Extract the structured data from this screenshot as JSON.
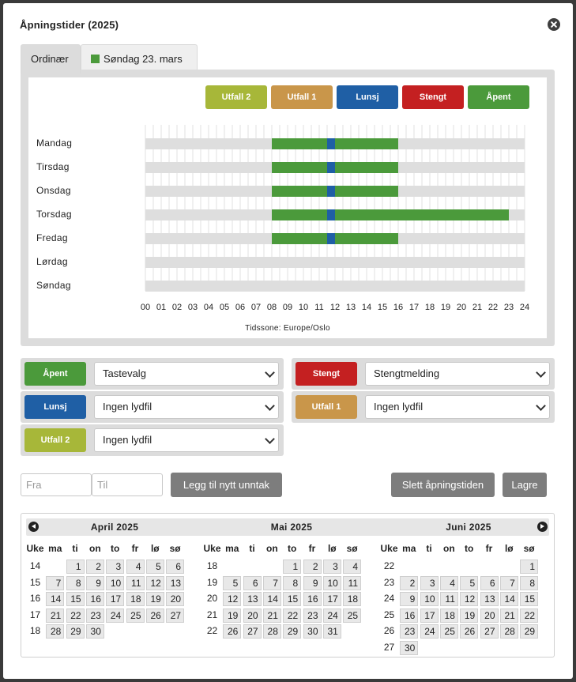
{
  "dialog": {
    "title": "Åpningstider (2025)"
  },
  "tabs": [
    {
      "label": "Ordinær",
      "active": true
    },
    {
      "label": "Søndag 23. mars",
      "active": false,
      "color": "#4b9a3b"
    }
  ],
  "legend": [
    {
      "label": "Utfall 2",
      "color": "#a7b739"
    },
    {
      "label": "Utfall 1",
      "color": "#c9964a"
    },
    {
      "label": "Lunsj",
      "color": "#1f5fa5"
    },
    {
      "label": "Stengt",
      "color": "#c42021"
    },
    {
      "label": "Åpent",
      "color": "#4b9a3b"
    }
  ],
  "chart_data": {
    "type": "timeline",
    "hours_ticks": [
      "00",
      "01",
      "02",
      "03",
      "04",
      "05",
      "06",
      "07",
      "08",
      "09",
      "10",
      "11",
      "12",
      "13",
      "14",
      "15",
      "16",
      "17",
      "18",
      "19",
      "20",
      "21",
      "22",
      "23",
      "24"
    ],
    "timezone": "Tidssone: Europe/Oslo",
    "days": [
      {
        "name": "Mandag",
        "segments": [
          {
            "type": "open",
            "start": 8,
            "end": 11.5
          },
          {
            "type": "lunch",
            "start": 11.5,
            "end": 12
          },
          {
            "type": "open",
            "start": 12,
            "end": 16
          }
        ]
      },
      {
        "name": "Tirsdag",
        "segments": [
          {
            "type": "open",
            "start": 8,
            "end": 11.5
          },
          {
            "type": "lunch",
            "start": 11.5,
            "end": 12
          },
          {
            "type": "open",
            "start": 12,
            "end": 16
          }
        ]
      },
      {
        "name": "Onsdag",
        "segments": [
          {
            "type": "open",
            "start": 8,
            "end": 11.5
          },
          {
            "type": "lunch",
            "start": 11.5,
            "end": 12
          },
          {
            "type": "open",
            "start": 12,
            "end": 16
          }
        ]
      },
      {
        "name": "Torsdag",
        "segments": [
          {
            "type": "open",
            "start": 8,
            "end": 11.5
          },
          {
            "type": "lunch",
            "start": 11.5,
            "end": 12
          },
          {
            "type": "open",
            "start": 12,
            "end": 23
          }
        ]
      },
      {
        "name": "Fredag",
        "segments": [
          {
            "type": "open",
            "start": 8,
            "end": 11.5
          },
          {
            "type": "lunch",
            "start": 11.5,
            "end": 12
          },
          {
            "type": "open",
            "start": 12,
            "end": 16
          }
        ]
      },
      {
        "name": "Lørdag",
        "segments": []
      },
      {
        "name": "Søndag",
        "segments": []
      }
    ],
    "colors": {
      "open": "#4b9a3b",
      "lunch": "#1f5fa5",
      "empty": "#dedede"
    }
  },
  "settings": [
    {
      "label": "Åpent",
      "color": "#4b9a3b",
      "value": "Tastevalg"
    },
    {
      "label": "Stengt",
      "color": "#c42021",
      "value": "Stengtmelding"
    },
    {
      "label": "Lunsj",
      "color": "#1f5fa5",
      "value": "Ingen lydfil"
    },
    {
      "label": "Utfall 1",
      "color": "#c9964a",
      "value": "Ingen lydfil"
    },
    {
      "label": "Utfall 2",
      "color": "#a7b739",
      "value": "Ingen lydfil"
    }
  ],
  "exception": {
    "from_placeholder": "Fra",
    "to_placeholder": "Til",
    "add_label": "Legg til nytt unntak",
    "delete_label": "Slett åpningstiden",
    "save_label": "Lagre"
  },
  "calendar": {
    "weekday_headers": [
      "Uke",
      "ma",
      "ti",
      "on",
      "to",
      "fr",
      "lø",
      "sø"
    ],
    "months": [
      {
        "title": "April 2025",
        "offset": 1,
        "days": 30,
        "weeks": [
          "14",
          "15",
          "16",
          "17",
          "18"
        ]
      },
      {
        "title": "Mai 2025",
        "offset": 3,
        "days": 31,
        "weeks": [
          "18",
          "19",
          "20",
          "21",
          "22"
        ]
      },
      {
        "title": "Juni 2025",
        "offset": 6,
        "days": 30,
        "weeks": [
          "22",
          "23",
          "24",
          "25",
          "26",
          "27"
        ]
      }
    ]
  }
}
